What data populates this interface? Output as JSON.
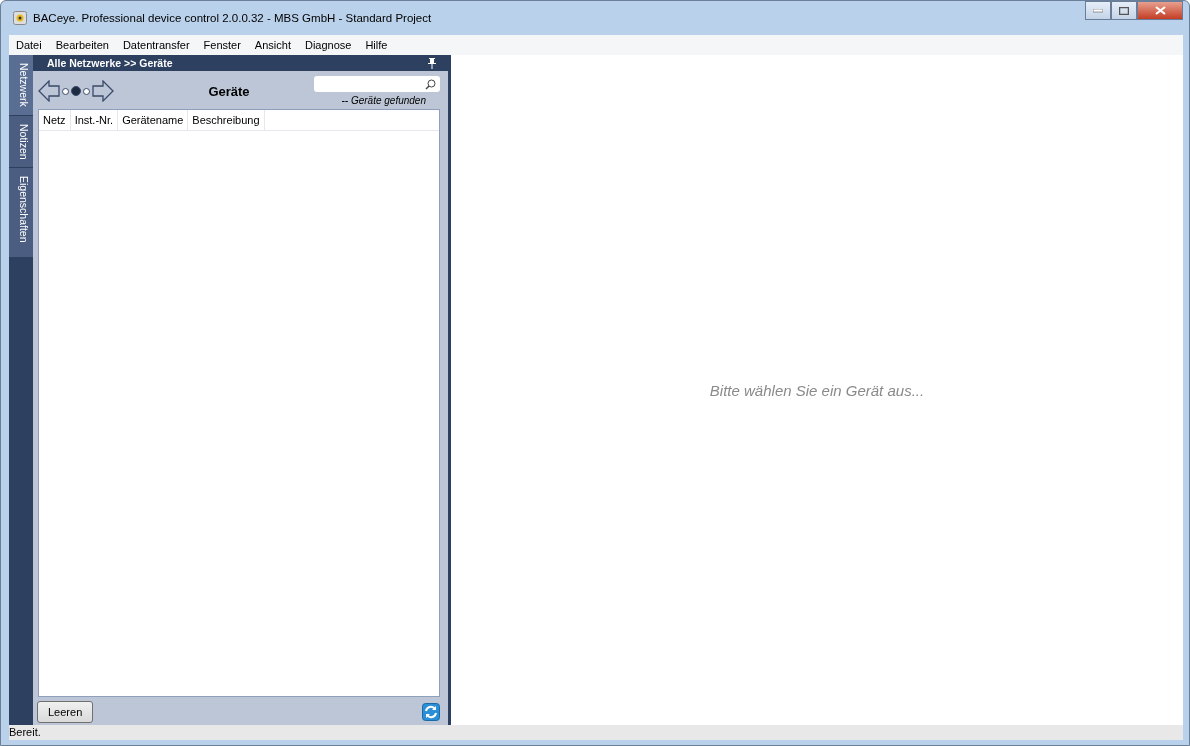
{
  "window": {
    "title": "BACeye. Professional device control 2.0.0.32 - MBS GmbH - Standard Project"
  },
  "menu": [
    "Datei",
    "Bearbeiten",
    "Datentransfer",
    "Fenster",
    "Ansicht",
    "Diagnose",
    "Hilfe"
  ],
  "side_tabs": [
    {
      "label": "Netzwerk",
      "selected": true
    },
    {
      "label": "Notizen",
      "selected": false
    },
    {
      "label": "Eigenschaften",
      "selected": false
    }
  ],
  "panel": {
    "breadcrumb": "Alle Netzwerke >> Geräte",
    "title": "Geräte",
    "steps": [
      {
        "selected": false
      },
      {
        "selected": true
      },
      {
        "selected": false
      }
    ],
    "found": "-- Geräte gefunden",
    "columns": [
      "Netz",
      "Inst.-Nr.",
      "Gerätename",
      "Beschreibung"
    ],
    "clear_button": "Leeren"
  },
  "main": {
    "message": "Bitte wählen Sie ein Gerät aus..."
  },
  "status_bar": "Bereit."
}
